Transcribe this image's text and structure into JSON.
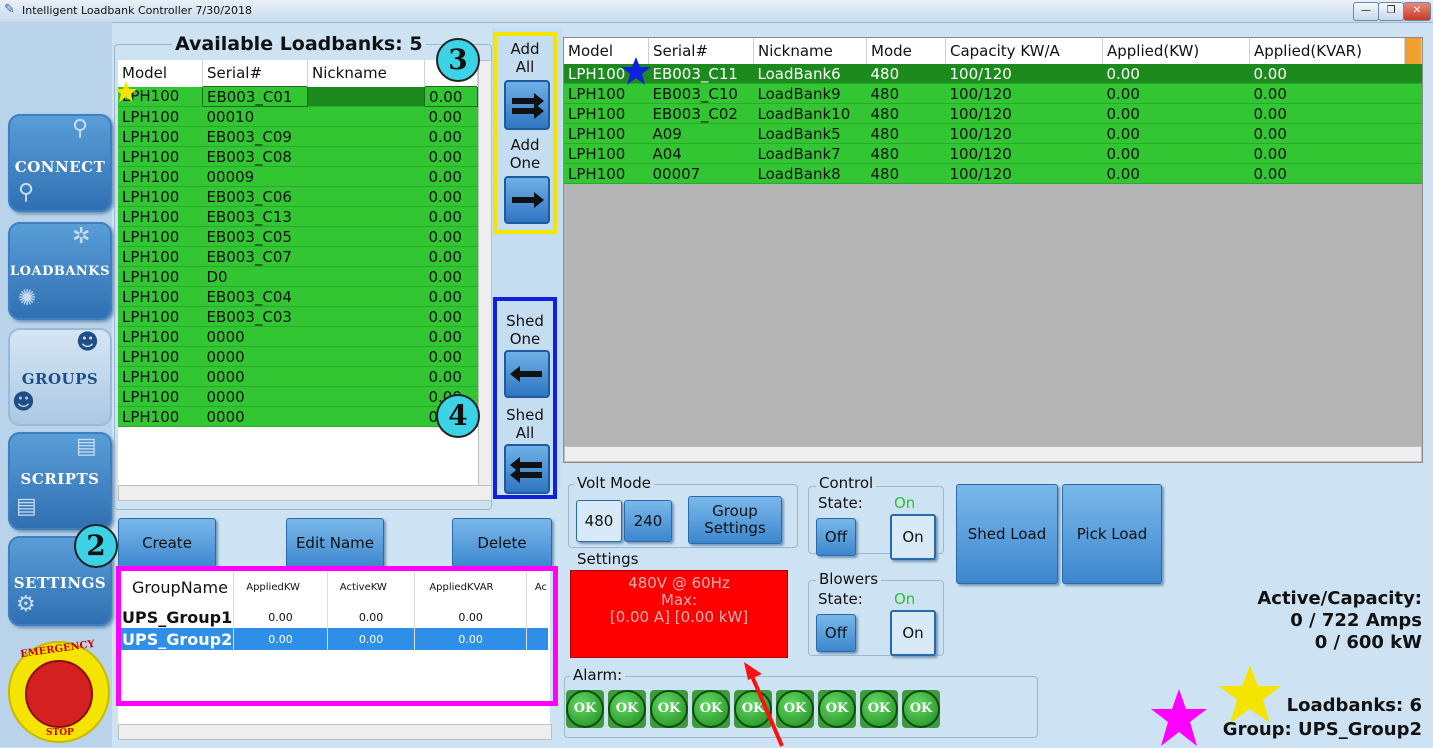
{
  "window": {
    "title": "Intelligent Loadbank Controller  7/30/2018",
    "min_glyph": "—",
    "max_glyph": "❐",
    "close_glyph": "✕"
  },
  "nav": {
    "connect": "CONNECT",
    "loadbanks": "LOADBANKS",
    "groups": "GROUPS",
    "scripts": "SCRIPTS",
    "settings": "SETTINGS",
    "emergency_top": "EMERGENCY",
    "emergency_bottom": "STOP"
  },
  "available": {
    "title": "Available Loadbanks: 5",
    "columns": [
      "Model",
      "Serial#",
      "Nickname"
    ],
    "rows": [
      {
        "model": "LPH100",
        "serial": "EB003_C01",
        "nickname": "",
        "val": "0.00"
      },
      {
        "model": "LPH100",
        "serial": "00010",
        "nickname": "",
        "val": "0.00"
      },
      {
        "model": "LPH100",
        "serial": "EB003_C09",
        "nickname": "",
        "val": "0.00"
      },
      {
        "model": "LPH100",
        "serial": "EB003_C08",
        "nickname": "",
        "val": "0.00"
      },
      {
        "model": "LPH100",
        "serial": "00009",
        "nickname": "",
        "val": "0.00"
      },
      {
        "model": "LPH100",
        "serial": "EB003_C06",
        "nickname": "",
        "val": "0.00"
      },
      {
        "model": "LPH100",
        "serial": "EB003_C13",
        "nickname": "",
        "val": "0.00"
      },
      {
        "model": "LPH100",
        "serial": "EB003_C05",
        "nickname": "",
        "val": "0.00"
      },
      {
        "model": "LPH100",
        "serial": "EB003_C07",
        "nickname": "",
        "val": "0.00"
      },
      {
        "model": "LPH100",
        "serial": "D0",
        "nickname": "",
        "val": "0.00"
      },
      {
        "model": "LPH100",
        "serial": "EB003_C04",
        "nickname": "",
        "val": "0.00"
      },
      {
        "model": "LPH100",
        "serial": "EB003_C03",
        "nickname": "",
        "val": "0.00"
      },
      {
        "model": "LPH100",
        "serial": "0000",
        "nickname": "",
        "val": "0.00"
      },
      {
        "model": "LPH100",
        "serial": "0000",
        "nickname": "",
        "val": "0.00"
      },
      {
        "model": "LPH100",
        "serial": "0000",
        "nickname": "",
        "val": "0.00"
      },
      {
        "model": "LPH100",
        "serial": "0000",
        "nickname": "",
        "val": "0.00"
      },
      {
        "model": "LPH100",
        "serial": "0000",
        "nickname": "",
        "val": "0.00"
      }
    ]
  },
  "transfer": {
    "add_all": "Add All",
    "add_one": "Add One",
    "shed_one": "Shed One",
    "shed_all": "Shed All"
  },
  "callouts": {
    "c2": "2",
    "c3": "3",
    "c4": "4"
  },
  "group_table": {
    "columns": [
      "Model",
      "Serial#",
      "Nickname",
      "Mode",
      "Capacity KW/A",
      "Applied(KW)",
      "Applied(KVAR)"
    ],
    "rows": [
      {
        "model": "LPH100",
        "serial": "EB003_C11",
        "nickname": "LoadBank6",
        "mode": "480",
        "capacity": "100/120",
        "kw": "0.00",
        "kvar": "0.00"
      },
      {
        "model": "LPH100",
        "serial": "EB003_C10",
        "nickname": "LoadBank9",
        "mode": "480",
        "capacity": "100/120",
        "kw": "0.00",
        "kvar": "0.00"
      },
      {
        "model": "LPH100",
        "serial": "EB003_C02",
        "nickname": "LoadBank10",
        "mode": "480",
        "capacity": "100/120",
        "kw": "0.00",
        "kvar": "0.00"
      },
      {
        "model": "LPH100",
        "serial": "A09",
        "nickname": "LoadBank5",
        "mode": "480",
        "capacity": "100/120",
        "kw": "0.00",
        "kvar": "0.00"
      },
      {
        "model": "LPH100",
        "serial": "A04",
        "nickname": "LoadBank7",
        "mode": "480",
        "capacity": "100/120",
        "kw": "0.00",
        "kvar": "0.00"
      },
      {
        "model": "LPH100",
        "serial": "00007",
        "nickname": "LoadBank8",
        "mode": "480",
        "capacity": "100/120",
        "kw": "0.00",
        "kvar": "0.00"
      }
    ]
  },
  "group_buttons": {
    "create": "Create",
    "edit": "Edit Name",
    "delete": "Delete"
  },
  "groups_list": {
    "columns": [
      "GroupName",
      "AppliedKW",
      "ActiveKW",
      "AppliedKVAR",
      "Ac"
    ],
    "rows": [
      {
        "name": "UPS_Group1",
        "kw": "0.00",
        "active": "0.00",
        "kvar": "0.00"
      },
      {
        "name": "UPS_Group2",
        "kw": "0.00",
        "active": "0.00",
        "kvar": "0.00"
      }
    ]
  },
  "volt_mode": {
    "label": "Volt Mode",
    "v480": "480",
    "v240": "240",
    "group_settings": "Group Settings"
  },
  "settings": {
    "label": "Settings",
    "line1": "480V @ 60Hz",
    "line2": "Max:",
    "line3": "[0.00 A] [0.00 kW]"
  },
  "control": {
    "label": "Control",
    "state_label": "State:",
    "state": "On",
    "off": "Off",
    "on": "On"
  },
  "blowers": {
    "label": "Blowers",
    "state_label": "State:",
    "state": "On",
    "off": "Off",
    "on": "On"
  },
  "actions": {
    "shed_load": "Shed Load",
    "pick_load": "Pick Load"
  },
  "alarm": {
    "label": "Alarm:",
    "items": [
      "OK",
      "OK",
      "OK",
      "OK",
      "OK",
      "OK",
      "OK",
      "OK",
      "OK"
    ]
  },
  "summary": {
    "title": "Active/Capacity:",
    "amps": "0 / 722 Amps",
    "kw": "0 / 600 kW",
    "loadbanks": "Loadbanks: 6",
    "group": "Group: UPS_Group2"
  },
  "colors": {
    "row_green": "#33c633",
    "highlight_yellow": "#f5e400",
    "highlight_blue": "#1020e0",
    "highlight_magenta": "#ff00ff",
    "settings_red": "#ff0000"
  }
}
